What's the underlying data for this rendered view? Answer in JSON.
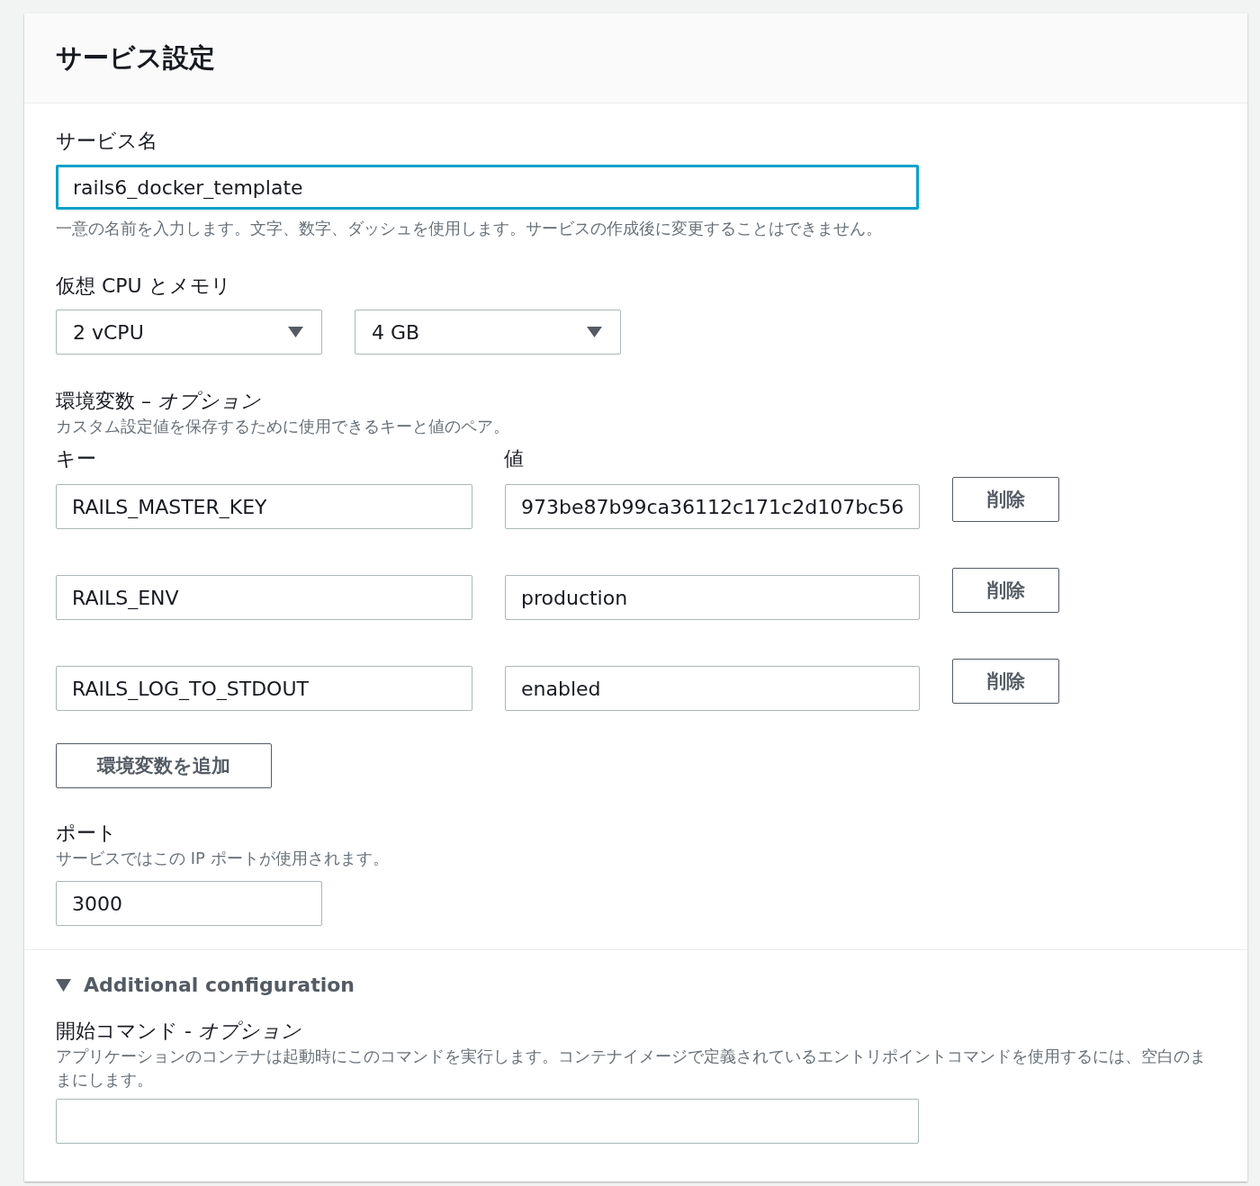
{
  "panel": {
    "title": "サービス設定"
  },
  "service_name": {
    "label": "サービス名",
    "value": "rails6_docker_template",
    "focused": true,
    "hint": "一意の名前を入力します。文字、数字、ダッシュを使用します。サービスの作成後に変更することはできません。"
  },
  "cpu_memory": {
    "label": "仮想 CPU とメモリ",
    "selects": [
      {
        "value": "2 vCPU"
      },
      {
        "value": "4 GB"
      }
    ]
  },
  "env_vars": {
    "label": "環境変数 – *オプション*",
    "hint": "カスタム設定値を保存するために使用できるキーと値のペア。",
    "key_heading": "キー",
    "value_heading": "値",
    "rows": [
      {
        "key": "RAILS_MASTER_KEY",
        "value": "973be87b99ca36112c171c2d107bc56",
        "button": "削除"
      },
      {
        "key": "RAILS_ENV",
        "value": "production",
        "button": "削除"
      },
      {
        "key": "RAILS_LOG_TO_STDOUT",
        "value": "enabled",
        "button": "削除"
      }
    ],
    "add_button": "環境変数を追加"
  },
  "port": {
    "label": "ポート",
    "hint": "サービスではこの IP ポートが使用されます。",
    "value": "3000"
  },
  "additional": {
    "title": "Additional configuration",
    "expanded": true,
    "start_command": {
      "label": "開始コマンド - *オプション*",
      "hint": "アプリケーションのコンテナは起動時にこのコマンドを実行します。コンテナイメージで定義されているエントリポイントコマンドを使用するには、空白のままにします。"
    }
  }
}
